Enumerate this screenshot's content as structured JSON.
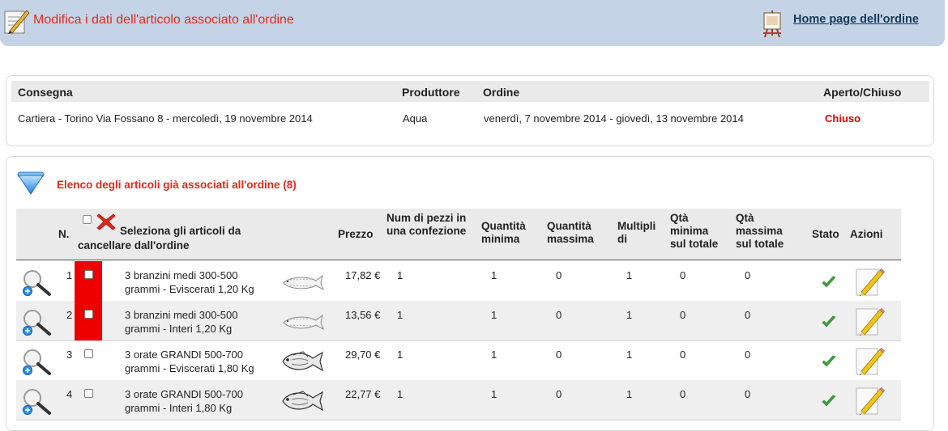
{
  "header": {
    "title": "Modifica i dati dell'articolo associato all'ordine",
    "home_link": "Home page dell'ordine"
  },
  "order_info": {
    "columns": [
      "Consegna",
      "Produttore",
      "Ordine",
      "Aperto/Chiuso"
    ],
    "delivery": "Cartiera - Torino Via Fossano 8 - mercoledì, 19 novembre 2014",
    "producer": "Aqua",
    "order": "venerdì, 7 novembre 2014 - giovedì, 13 novembre 2014",
    "status": "Chiuso",
    "status_color": "#e00000"
  },
  "articles": {
    "title": "Elenco degli articoli già associati all'ordine (8)",
    "columns": {
      "n": "N.",
      "select": "Seleziona gli articoli da cancellare dall'ordine",
      "price": "Prezzo",
      "pieces": "Num di pezzi in una confezione",
      "qty_min": "Quantità minima",
      "qty_max": "Quantità massima",
      "multiples": "Multipli di",
      "qty_min_total": "Qtà minima sul totale",
      "qty_max_total": "Qtà massima sul totale",
      "status": "Stato",
      "actions": "Azioni"
    },
    "rows": [
      {
        "n": "1",
        "name_l1": "3 branzini medi 300-500",
        "name_l2": "grammi - Eviscerati 1,20 Kg",
        "price": "17,82 €",
        "pieces": "1",
        "qty_min": "1",
        "qty_max": "0",
        "multiples": "1",
        "qty_min_total": "0",
        "qty_max_total": "0",
        "highlighted": true,
        "fish": "sea-bass-icon"
      },
      {
        "n": "2",
        "name_l1": "3 branzini medi 300-500",
        "name_l2": "grammi - Interi 1,20 Kg",
        "price": "13,56 €",
        "pieces": "1",
        "qty_min": "1",
        "qty_max": "0",
        "multiples": "1",
        "qty_min_total": "0",
        "qty_max_total": "0",
        "highlighted": true,
        "fish": "sea-bass-icon"
      },
      {
        "n": "3",
        "name_l1": "3 orate GRANDI 500-700",
        "name_l2": "grammi - Eviscerati 1,80 Kg",
        "price": "29,70 €",
        "pieces": "1",
        "qty_min": "1",
        "qty_max": "0",
        "multiples": "1",
        "qty_min_total": "0",
        "qty_max_total": "0",
        "highlighted": false,
        "fish": "sea-bream-icon"
      },
      {
        "n": "4",
        "name_l1": "3 orate GRANDI 500-700",
        "name_l2": "grammi - Interi 1,80 Kg",
        "price": "22,77 €",
        "pieces": "1",
        "qty_min": "1",
        "qty_max": "0",
        "multiples": "1",
        "qty_min_total": "0",
        "qty_max_total": "0",
        "highlighted": false,
        "fish": "sea-bream-icon"
      }
    ]
  },
  "colors": {
    "title_red": "#e02b20",
    "header_bg": "#c5d3e6",
    "highlight_red": "#ee0000",
    "check_green": "#3aa537"
  }
}
